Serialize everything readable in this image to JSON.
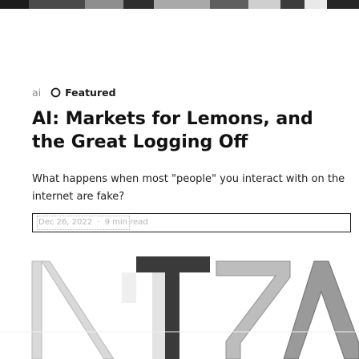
{
  "post": {
    "tag": "ai",
    "featured_label": "Featured",
    "title": "AI: Markets for Lemons, and the Great Logging Off",
    "subtitle": "What happens when most \"people\" you interact with on the internet are fake?",
    "meta": {
      "date": "Dec 26, 2022",
      "separator": "·",
      "read_time": "9 min read"
    }
  },
  "icons": {
    "featured": "star-outline-icon"
  }
}
